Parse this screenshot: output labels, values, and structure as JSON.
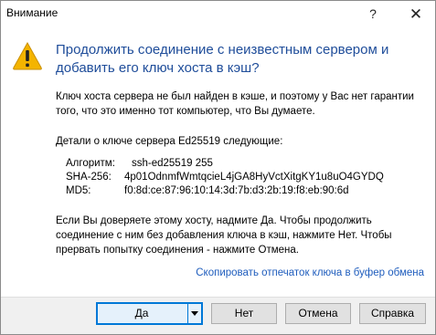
{
  "window": {
    "title": "Внимание",
    "help_glyph": "?",
    "close_glyph": "✕"
  },
  "icon": "warning-icon",
  "heading": {
    "line1": "Продолжить соединение с неизвестным сервером и",
    "line2": "добавить его ключ хоста в кэш?"
  },
  "message": {
    "line1": "Ключ хоста сервера не был найден в кэше, и поэтому у Вас нет гарантии",
    "line2": "того, что это именно тот компьютер, что Вы думаете."
  },
  "details": {
    "intro": "Детали о ключе сервера Ed25519 следующие:",
    "algorithm_label": "Алгоритм:",
    "algorithm_value": "ssh-ed25519 255",
    "sha256_label": "SHA-256:",
    "sha256_value": "4p01OdnmfWmtqcieL4jGA8HyVctXitgKY1u8uO4GYDQ",
    "md5_label": "MD5:",
    "md5_value": "f0:8d:ce:87:96:10:14:3d:7b:d3:2b:19:f8:eb:90:6d"
  },
  "instructions": {
    "line1": "Если Вы доверяете этому хосту, надмите Да. Чтобы продолжить",
    "line2": "соединение с ним без добавления ключа в кэш, нажмите Нет. Чтобы",
    "line3": "прервать попытку соединения - нажмите Отмена."
  },
  "copy_link": "Скопировать отпечаток ключа в буфер обмена",
  "buttons": {
    "yes": "Да",
    "no": "Нет",
    "cancel": "Отмена",
    "help": "Справка"
  },
  "colors": {
    "heading": "#1f4d9a",
    "link": "#1f5dbd",
    "default_button_border": "#0078d7",
    "warning_fill": "#f4b400"
  }
}
